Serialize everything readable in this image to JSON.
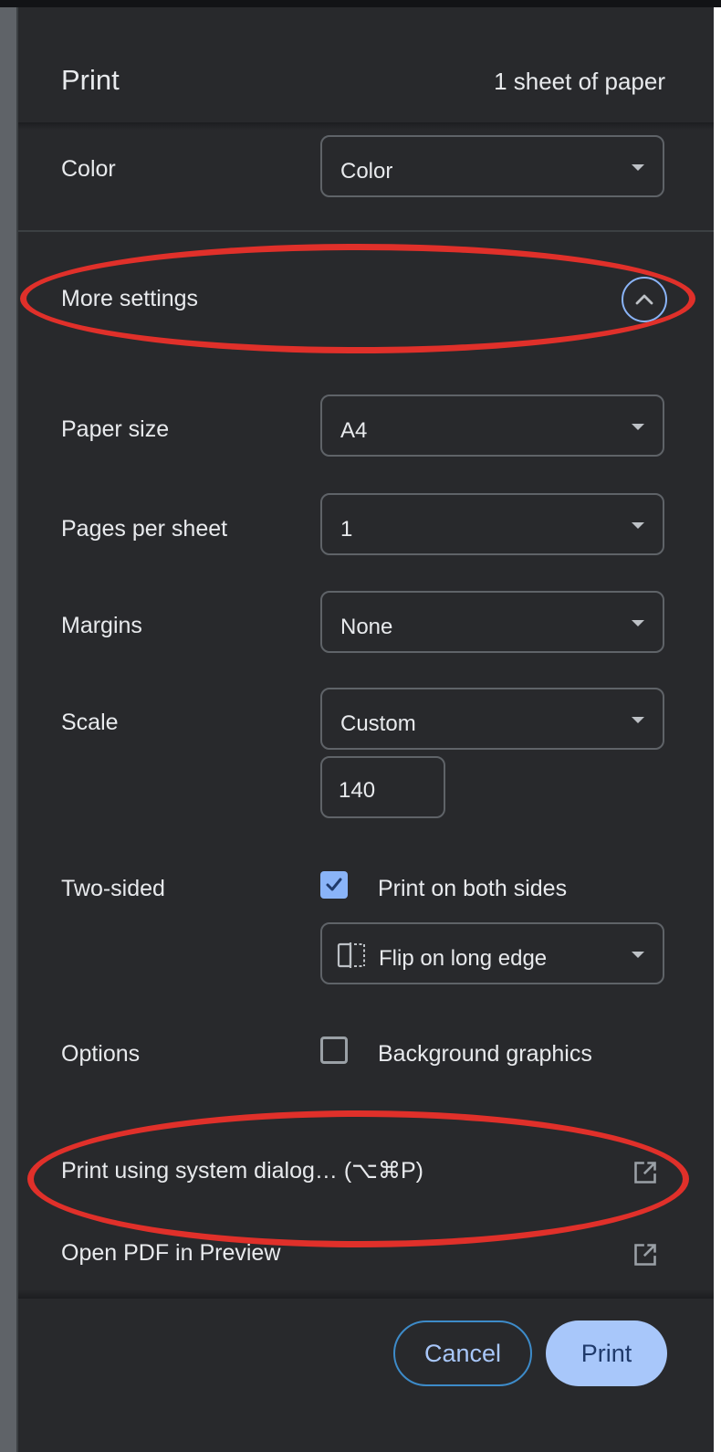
{
  "dialog": {
    "title": "Print",
    "sheet_count": "1 sheet of paper"
  },
  "color": {
    "label": "Color",
    "value": "Color"
  },
  "more_settings": {
    "label": "More settings",
    "expanded": true
  },
  "paper_size": {
    "label": "Paper size",
    "value": "A4"
  },
  "pages_per_sheet": {
    "label": "Pages per sheet",
    "value": "1"
  },
  "margins": {
    "label": "Margins",
    "value": "None"
  },
  "scale": {
    "label": "Scale",
    "value": "Custom",
    "custom_value": "140"
  },
  "two_sided": {
    "label": "Two-sided",
    "checkbox_label": "Print on both sides",
    "checked": true,
    "flip_value": "Flip on long edge"
  },
  "options": {
    "label": "Options",
    "checkbox_label": "Background graphics",
    "checked": false
  },
  "links": {
    "system_dialog": "Print using system dialog… (⌥⌘P)",
    "open_pdf": "Open PDF in Preview"
  },
  "buttons": {
    "cancel": "Cancel",
    "print": "Print"
  },
  "colors": {
    "accent": "#8ab4f8",
    "primary_button": "#a8c7fa",
    "annotation": "#e0302a",
    "background": "#28292c"
  },
  "icons": [
    "chevron-up-icon",
    "checkmark-icon",
    "flip-long-edge-icon",
    "open-external-icon"
  ]
}
